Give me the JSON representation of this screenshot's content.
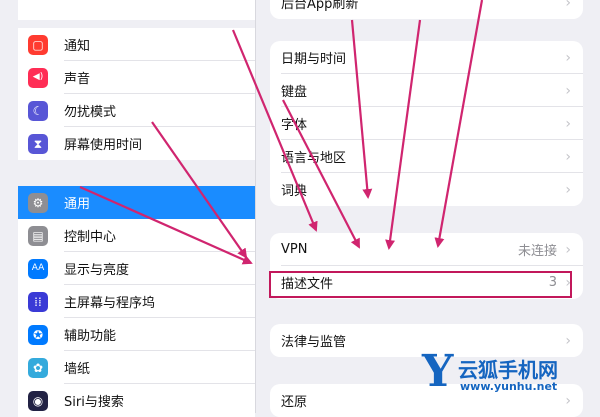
{
  "sidebar": {
    "group1": [
      {
        "label": "通知",
        "icon": "notification-icon",
        "color": "#ff3b30",
        "glyph": "▢"
      },
      {
        "label": "声音",
        "icon": "speaker-icon",
        "color": "#ff2d55",
        "glyph": "◀)"
      },
      {
        "label": "勿扰模式",
        "icon": "moon-icon",
        "color": "#5856d6",
        "glyph": "☾"
      },
      {
        "label": "屏幕使用时间",
        "icon": "hourglass-icon",
        "color": "#5856d6",
        "glyph": "⧗"
      }
    ],
    "group2": [
      {
        "label": "通用",
        "icon": "gear-icon",
        "color": "#8e8e93",
        "glyph": "⚙",
        "selected": true
      },
      {
        "label": "控制中心",
        "icon": "control-center-icon",
        "color": "#8e8e93",
        "glyph": "▤"
      },
      {
        "label": "显示与亮度",
        "icon": "display-icon",
        "color": "#007aff",
        "glyph": "AA"
      },
      {
        "label": "主屏幕与程序坞",
        "icon": "home-screen-icon",
        "color": "#3a3ad6",
        "glyph": "⁞⁞"
      },
      {
        "label": "辅助功能",
        "icon": "accessibility-icon",
        "color": "#007aff",
        "glyph": "✪"
      },
      {
        "label": "墙纸",
        "icon": "wallpaper-icon",
        "color": "#34aadc",
        "glyph": "✿"
      },
      {
        "label": "Siri与搜索",
        "icon": "siri-icon",
        "color": "#222244",
        "glyph": "◉"
      }
    ]
  },
  "main": {
    "top_cut_label": "后台App刷新",
    "group_datetime": [
      "日期与时间",
      "键盘",
      "字体",
      "语言与地区",
      "词典"
    ],
    "vpn": {
      "label": "VPN",
      "status": "未连接"
    },
    "profile": {
      "label": "描述文件",
      "count": "3"
    },
    "legal": {
      "label": "法律与监管"
    },
    "reset": {
      "label": "还原"
    }
  },
  "chevron": "›",
  "watermark": {
    "letter": "Y",
    "title": "云狐手机网",
    "url": "www.yunhu.net"
  },
  "colors": {
    "selected": "#1a8cff",
    "arrow": "#d0256f",
    "watermark": "#1565c0"
  }
}
